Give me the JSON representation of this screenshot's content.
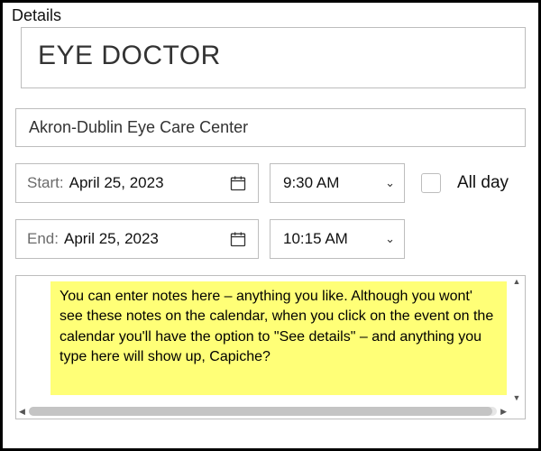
{
  "section_label": "Details",
  "title": "EYE DOCTOR",
  "location": "Akron-Dublin Eye Care Center",
  "start": {
    "label": "Start:",
    "date": "April 25, 2023",
    "time": "9:30 AM"
  },
  "end": {
    "label": "End:",
    "date": "April 25, 2023",
    "time": "10:15 AM"
  },
  "allday": {
    "label": "All day",
    "checked": false
  },
  "notes": "You can enter notes here – anything you like. Although you wont' see these notes on the calendar, when you click on the event on the calendar you'll have the option to \"See details\" – and anything you type here will show up, Capiche?"
}
